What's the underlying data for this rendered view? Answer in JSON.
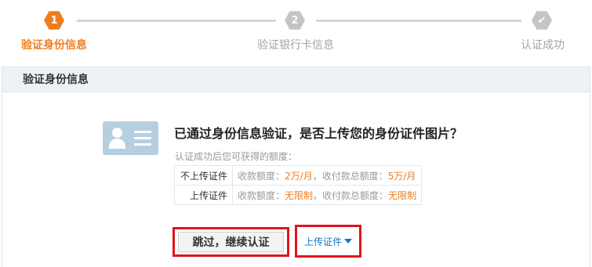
{
  "steps": [
    {
      "number": "1",
      "label": "验证身份信息",
      "state": "active"
    },
    {
      "number": "2",
      "label": "验证银行卡信息",
      "state": "pending"
    },
    {
      "number": "✔",
      "label": "认证成功",
      "state": "pending"
    }
  ],
  "panel": {
    "title": "验证身份信息"
  },
  "question": "已通过身份信息验证，是否上传您的身份证件图片？",
  "hint": "认证成功后您可获得的额度：",
  "quota_rows": [
    {
      "label": "不上传证件",
      "receive_label": "收款额度：",
      "receive_value": "2万/月",
      "sep": "，",
      "pay_label": "收付款总额度：",
      "pay_value": "5万/月"
    },
    {
      "label": "上传证件",
      "receive_label": "收款额度：",
      "receive_value": "无限制",
      "sep": "，",
      "pay_label": "收付款总额度：",
      "pay_value": "无限制"
    }
  ],
  "buttons": {
    "skip": "跳过，继续认证",
    "upload": "上传证件"
  },
  "icons": {
    "id_card": "id-card-icon",
    "dropdown": "caret-down-icon",
    "check": "check-icon"
  },
  "colors": {
    "accent": "#f07d1c",
    "inactive": "#c4c4c4",
    "link": "#1578c2",
    "highlight_box": "#e1141c"
  }
}
